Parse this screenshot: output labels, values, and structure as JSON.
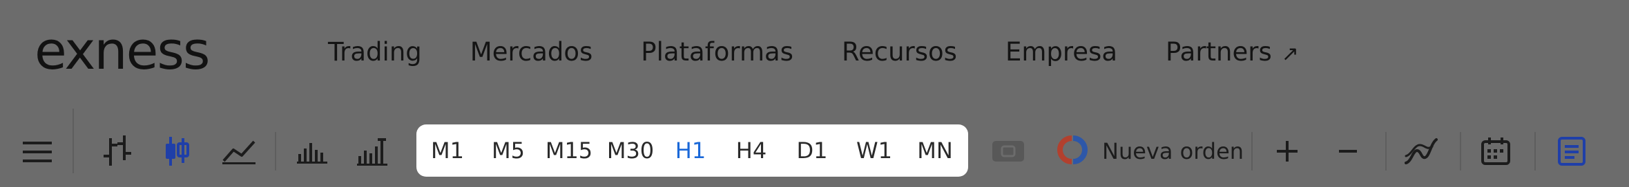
{
  "header": {
    "logo_text": "exness",
    "nav": [
      {
        "label": "Trading"
      },
      {
        "label": "Mercados"
      },
      {
        "label": "Plataformas"
      },
      {
        "label": "Recursos"
      },
      {
        "label": "Empresa"
      },
      {
        "label": "Partners",
        "icon": "external-arrow-icon",
        "arrow_glyph": "↗"
      }
    ]
  },
  "toolbar": {
    "timeframes": [
      "M1",
      "M5",
      "M15",
      "M30",
      "H1",
      "H4",
      "D1",
      "W1",
      "MN"
    ],
    "active_timeframe": "H1",
    "new_order_label": "Nueva orden",
    "icons": [
      "hamburger-menu-icon",
      "bar-chart-icon",
      "candlestick-chart-icon",
      "line-chart-icon",
      "volume-chart-icon",
      "tick-volume-chart-icon",
      "one-click-trading-icon",
      "new-order-icon",
      "zoom-in-icon",
      "zoom-out-icon",
      "indicators-icon",
      "calendar-icon",
      "order-panel-icon"
    ]
  },
  "colors": {
    "background": "#6c6c6c",
    "accent": "#1a68d8",
    "order_red": "#b2402e",
    "order_blue": "#2d57a8",
    "active_icon": "#1f3fa8",
    "timeframe_panel": "#ffffff"
  }
}
